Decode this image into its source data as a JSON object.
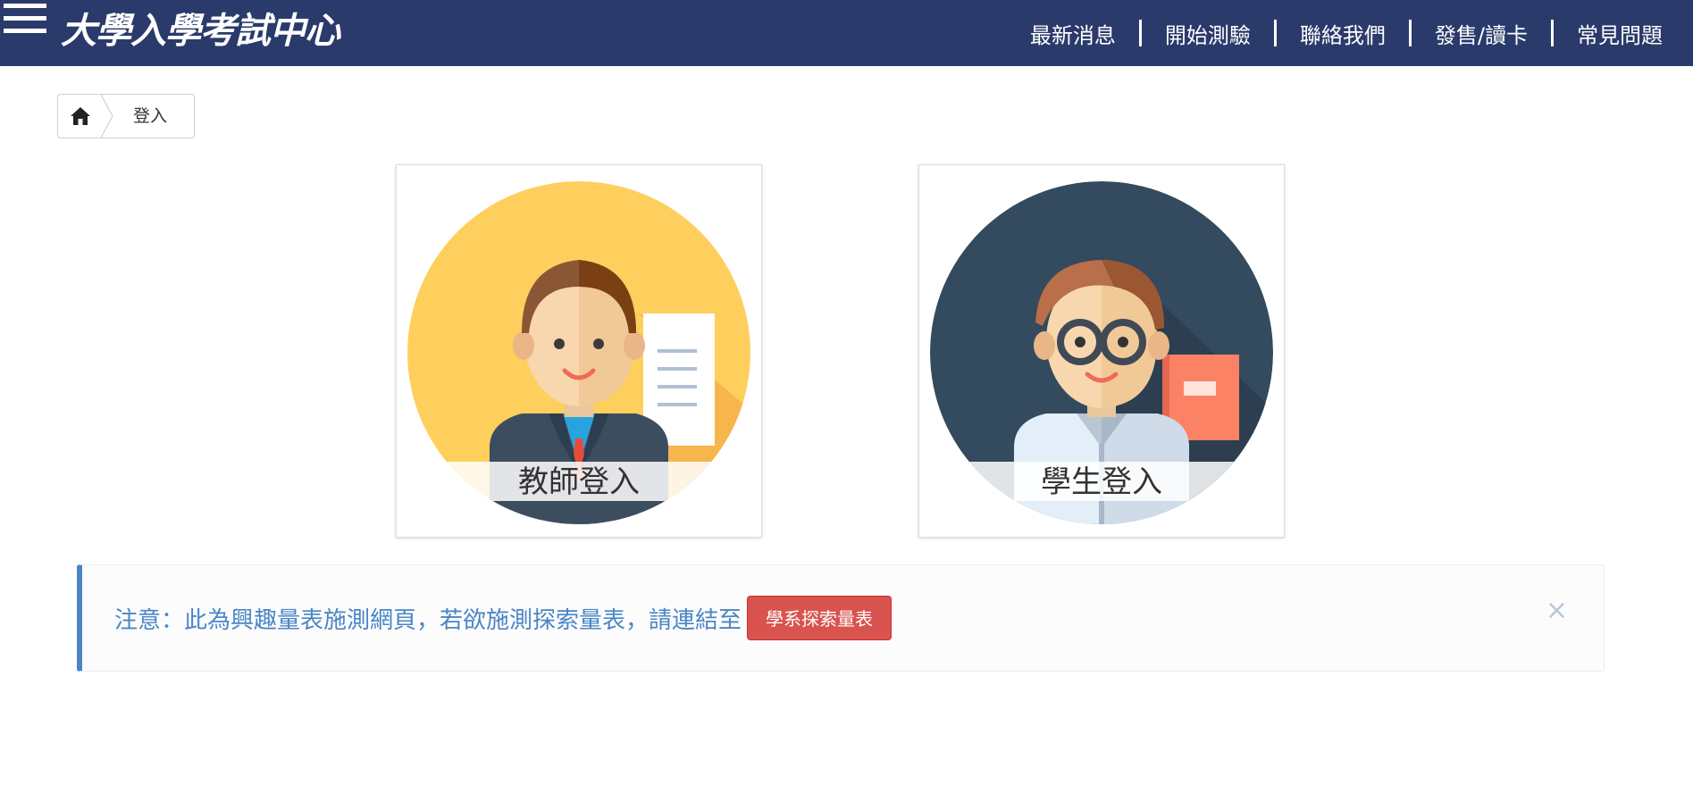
{
  "header": {
    "logo_text": "大學入學考試中心",
    "nav": [
      "最新消息",
      "開始測驗",
      "聯絡我們",
      "發售/讀卡",
      "常見問題"
    ]
  },
  "breadcrumb": {
    "home_icon": "home-icon",
    "current": "登入"
  },
  "cards": {
    "teacher_label": "教師登入",
    "student_label": "學生登入"
  },
  "alert": {
    "message": "注意：此為興趣量表施測網頁，若欲施測探索量表，請連結至",
    "button_label": "學系探索量表",
    "close_symbol": "×"
  },
  "colors": {
    "header_bg": "#2a3a6b",
    "alert_accent": "#4a86c4",
    "button_red": "#d9534f",
    "teacher_bg": "#fecf5c",
    "student_bg": "#344a5e"
  }
}
